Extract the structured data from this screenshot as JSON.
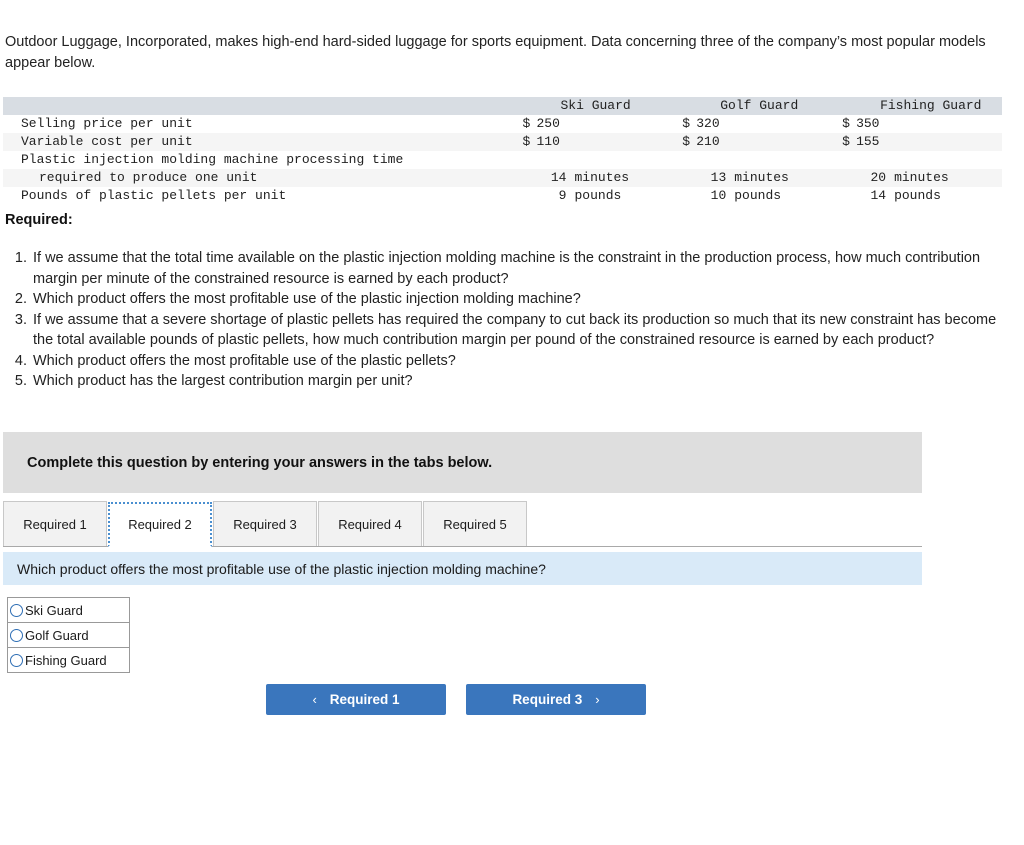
{
  "intro": {
    "paragraph": "Outdoor Luggage, Incorporated, makes high-end hard-sided luggage for sports equipment. Data concerning three of the company’s most popular models appear below."
  },
  "table": {
    "row_label_header": "",
    "columns": [
      "Ski Guard",
      "Golf Guard",
      "Fishing Guard"
    ],
    "rows": [
      {
        "label": "Selling price per unit",
        "indent": false,
        "cells": [
          {
            "currency": "$",
            "value": "250",
            "unit": ""
          },
          {
            "currency": "$",
            "value": "320",
            "unit": ""
          },
          {
            "currency": "$",
            "value": "350",
            "unit": ""
          }
        ]
      },
      {
        "label": "Variable cost per unit",
        "indent": false,
        "cells": [
          {
            "currency": "$",
            "value": "110",
            "unit": ""
          },
          {
            "currency": "$",
            "value": "210",
            "unit": ""
          },
          {
            "currency": "$",
            "value": "155",
            "unit": ""
          }
        ]
      },
      {
        "label": "Plastic injection molding machine processing time",
        "indent": false,
        "cells": [
          {
            "currency": "",
            "value": "",
            "unit": ""
          },
          {
            "currency": "",
            "value": "",
            "unit": ""
          },
          {
            "currency": "",
            "value": "",
            "unit": ""
          }
        ]
      },
      {
        "label": "required to produce one unit",
        "indent": true,
        "cells": [
          {
            "currency": "",
            "value": "14",
            "unit": "minutes"
          },
          {
            "currency": "",
            "value": "13",
            "unit": "minutes"
          },
          {
            "currency": "",
            "value": "20",
            "unit": "minutes"
          }
        ]
      },
      {
        "label": "Pounds of plastic pellets per unit",
        "indent": false,
        "cells": [
          {
            "currency": "",
            "value": "9",
            "unit": "pounds"
          },
          {
            "currency": "",
            "value": "10",
            "unit": "pounds"
          },
          {
            "currency": "",
            "value": "14",
            "unit": "pounds"
          }
        ]
      }
    ]
  },
  "required": {
    "heading": "Required:",
    "items": [
      "If we assume that the total time available on the plastic injection molding machine is the constraint in the production process, how much contribution margin per minute of the constrained resource is earned by each product?",
      "Which product offers the most profitable use of the plastic injection molding machine?",
      "If we assume that a severe shortage of plastic pellets has required the company to cut back its production so much that its new constraint has become the total available pounds of plastic pellets, how much contribution margin per pound of the constrained resource is earned by each product?",
      "Which product offers the most profitable use of the plastic pellets?",
      "Which product has the largest contribution margin per unit?"
    ]
  },
  "instruction_banner": {
    "text": "Complete this question by entering your answers in the tabs below."
  },
  "tabs": {
    "active_index": 1,
    "items": [
      {
        "label": "Required 1"
      },
      {
        "label": "Required 2"
      },
      {
        "label": "Required 3"
      },
      {
        "label": "Required 4"
      },
      {
        "label": "Required 5"
      }
    ]
  },
  "question_banner": {
    "text": "Which product offers the most profitable use of the plastic injection molding machine?"
  },
  "answer_options": {
    "selected": null,
    "items": [
      {
        "label": "Ski Guard",
        "checked": false
      },
      {
        "label": "Golf Guard",
        "checked": false
      },
      {
        "label": "Fishing Guard",
        "checked": false
      }
    ]
  },
  "navigation": {
    "prev_label": "Required 1",
    "next_label": "Required 3",
    "prev_icon": "‹",
    "next_icon": "›"
  },
  "colors": {
    "button_blue": "#3a76bd",
    "question_banner_blue": "#d9eaf8",
    "instruction_banner_gray": "#dedede",
    "table_header_gray": "#d8dde3",
    "table_stripe": "#f5f5f5",
    "radio_outline": "#2f6fb5",
    "active_tab_border": "#4a8fd0"
  }
}
